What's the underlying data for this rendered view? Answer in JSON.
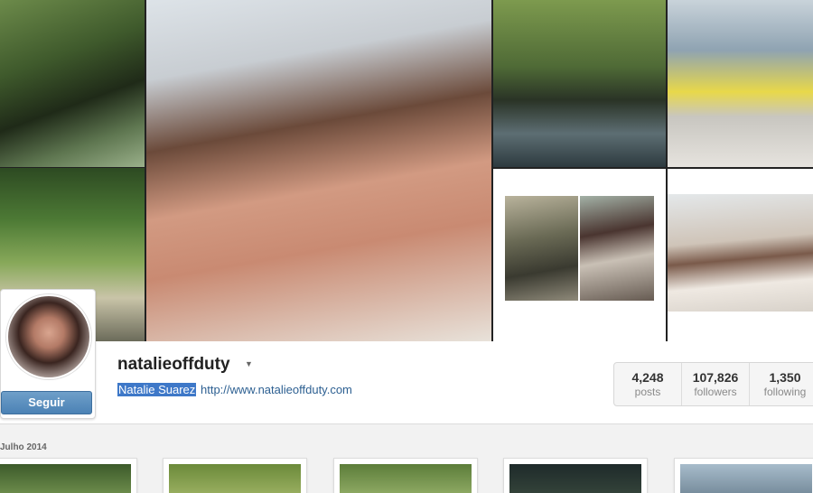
{
  "profile": {
    "username": "natalieoffduty",
    "full_name": "Natalie Suarez",
    "website": "http://www.natalieoffduty.com",
    "follow_label": "Seguir"
  },
  "stats": [
    {
      "value": "4,248",
      "label": "posts"
    },
    {
      "value": "107,826",
      "label": "followers"
    },
    {
      "value": "1,350",
      "label": "following"
    }
  ],
  "feed": {
    "month_label": "Julho 2014"
  },
  "colors": {
    "follow_button": "#4b82b5",
    "highlight": "#3e78c8",
    "link": "#2c5f91"
  }
}
